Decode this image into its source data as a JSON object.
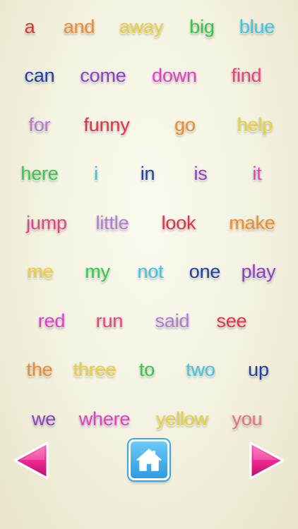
{
  "words": [
    {
      "text": "a",
      "color": "#e0322d"
    },
    {
      "text": "and",
      "color": "#f08a2a"
    },
    {
      "text": "away",
      "color": "#e8d238"
    },
    {
      "text": "big",
      "color": "#34c84a"
    },
    {
      "text": "blue",
      "color": "#3ec6e0"
    },
    {
      "text": "can",
      "color": "#1e3ea8"
    },
    {
      "text": "come",
      "color": "#8a3fc9"
    },
    {
      "text": "down",
      "color": "#e03fc8"
    },
    {
      "text": "find",
      "color": "#e8427a"
    },
    {
      "text": "for",
      "color": "#b07ad8"
    },
    {
      "text": "funny",
      "color": "#e03246"
    },
    {
      "text": "go",
      "color": "#f08a2a"
    },
    {
      "text": "help",
      "color": "#e8d238"
    },
    {
      "text": "here",
      "color": "#34c84a"
    },
    {
      "text": "i",
      "color": "#3ec6e0"
    },
    {
      "text": "in",
      "color": "#1e3ea8"
    },
    {
      "text": "is",
      "color": "#8a3fc9"
    },
    {
      "text": "it",
      "color": "#e03fc8"
    },
    {
      "text": "jump",
      "color": "#e8427a"
    },
    {
      "text": "little",
      "color": "#b07ad8"
    },
    {
      "text": "look",
      "color": "#e03246"
    },
    {
      "text": "make",
      "color": "#f08a2a"
    },
    {
      "text": "me",
      "color": "#e8d238"
    },
    {
      "text": "my",
      "color": "#34c84a"
    },
    {
      "text": "not",
      "color": "#3ec6e0"
    },
    {
      "text": "one",
      "color": "#1e3ea8"
    },
    {
      "text": "play",
      "color": "#8a3fc9"
    },
    {
      "text": "red",
      "color": "#e03fc8"
    },
    {
      "text": "run",
      "color": "#e8427a"
    },
    {
      "text": "said",
      "color": "#b07ad8"
    },
    {
      "text": "see",
      "color": "#e03246"
    },
    {
      "text": "the",
      "color": "#f08a2a"
    },
    {
      "text": "three",
      "color": "#e8d238"
    },
    {
      "text": "to",
      "color": "#34c84a"
    },
    {
      "text": "two",
      "color": "#3ec6e0"
    },
    {
      "text": "up",
      "color": "#1e3ea8"
    },
    {
      "text": "we",
      "color": "#8a3fc9"
    },
    {
      "text": "where",
      "color": "#e03fc8"
    },
    {
      "text": "yellow",
      "color": "#e8d238"
    },
    {
      "text": "you",
      "color": "#e8727a"
    }
  ],
  "nav": {
    "prev_icon": "left-arrow-icon",
    "next_icon": "right-arrow-icon",
    "home_icon": "house-icon",
    "arrow_color": "#e8208a",
    "home_color": "#2d9be0"
  }
}
